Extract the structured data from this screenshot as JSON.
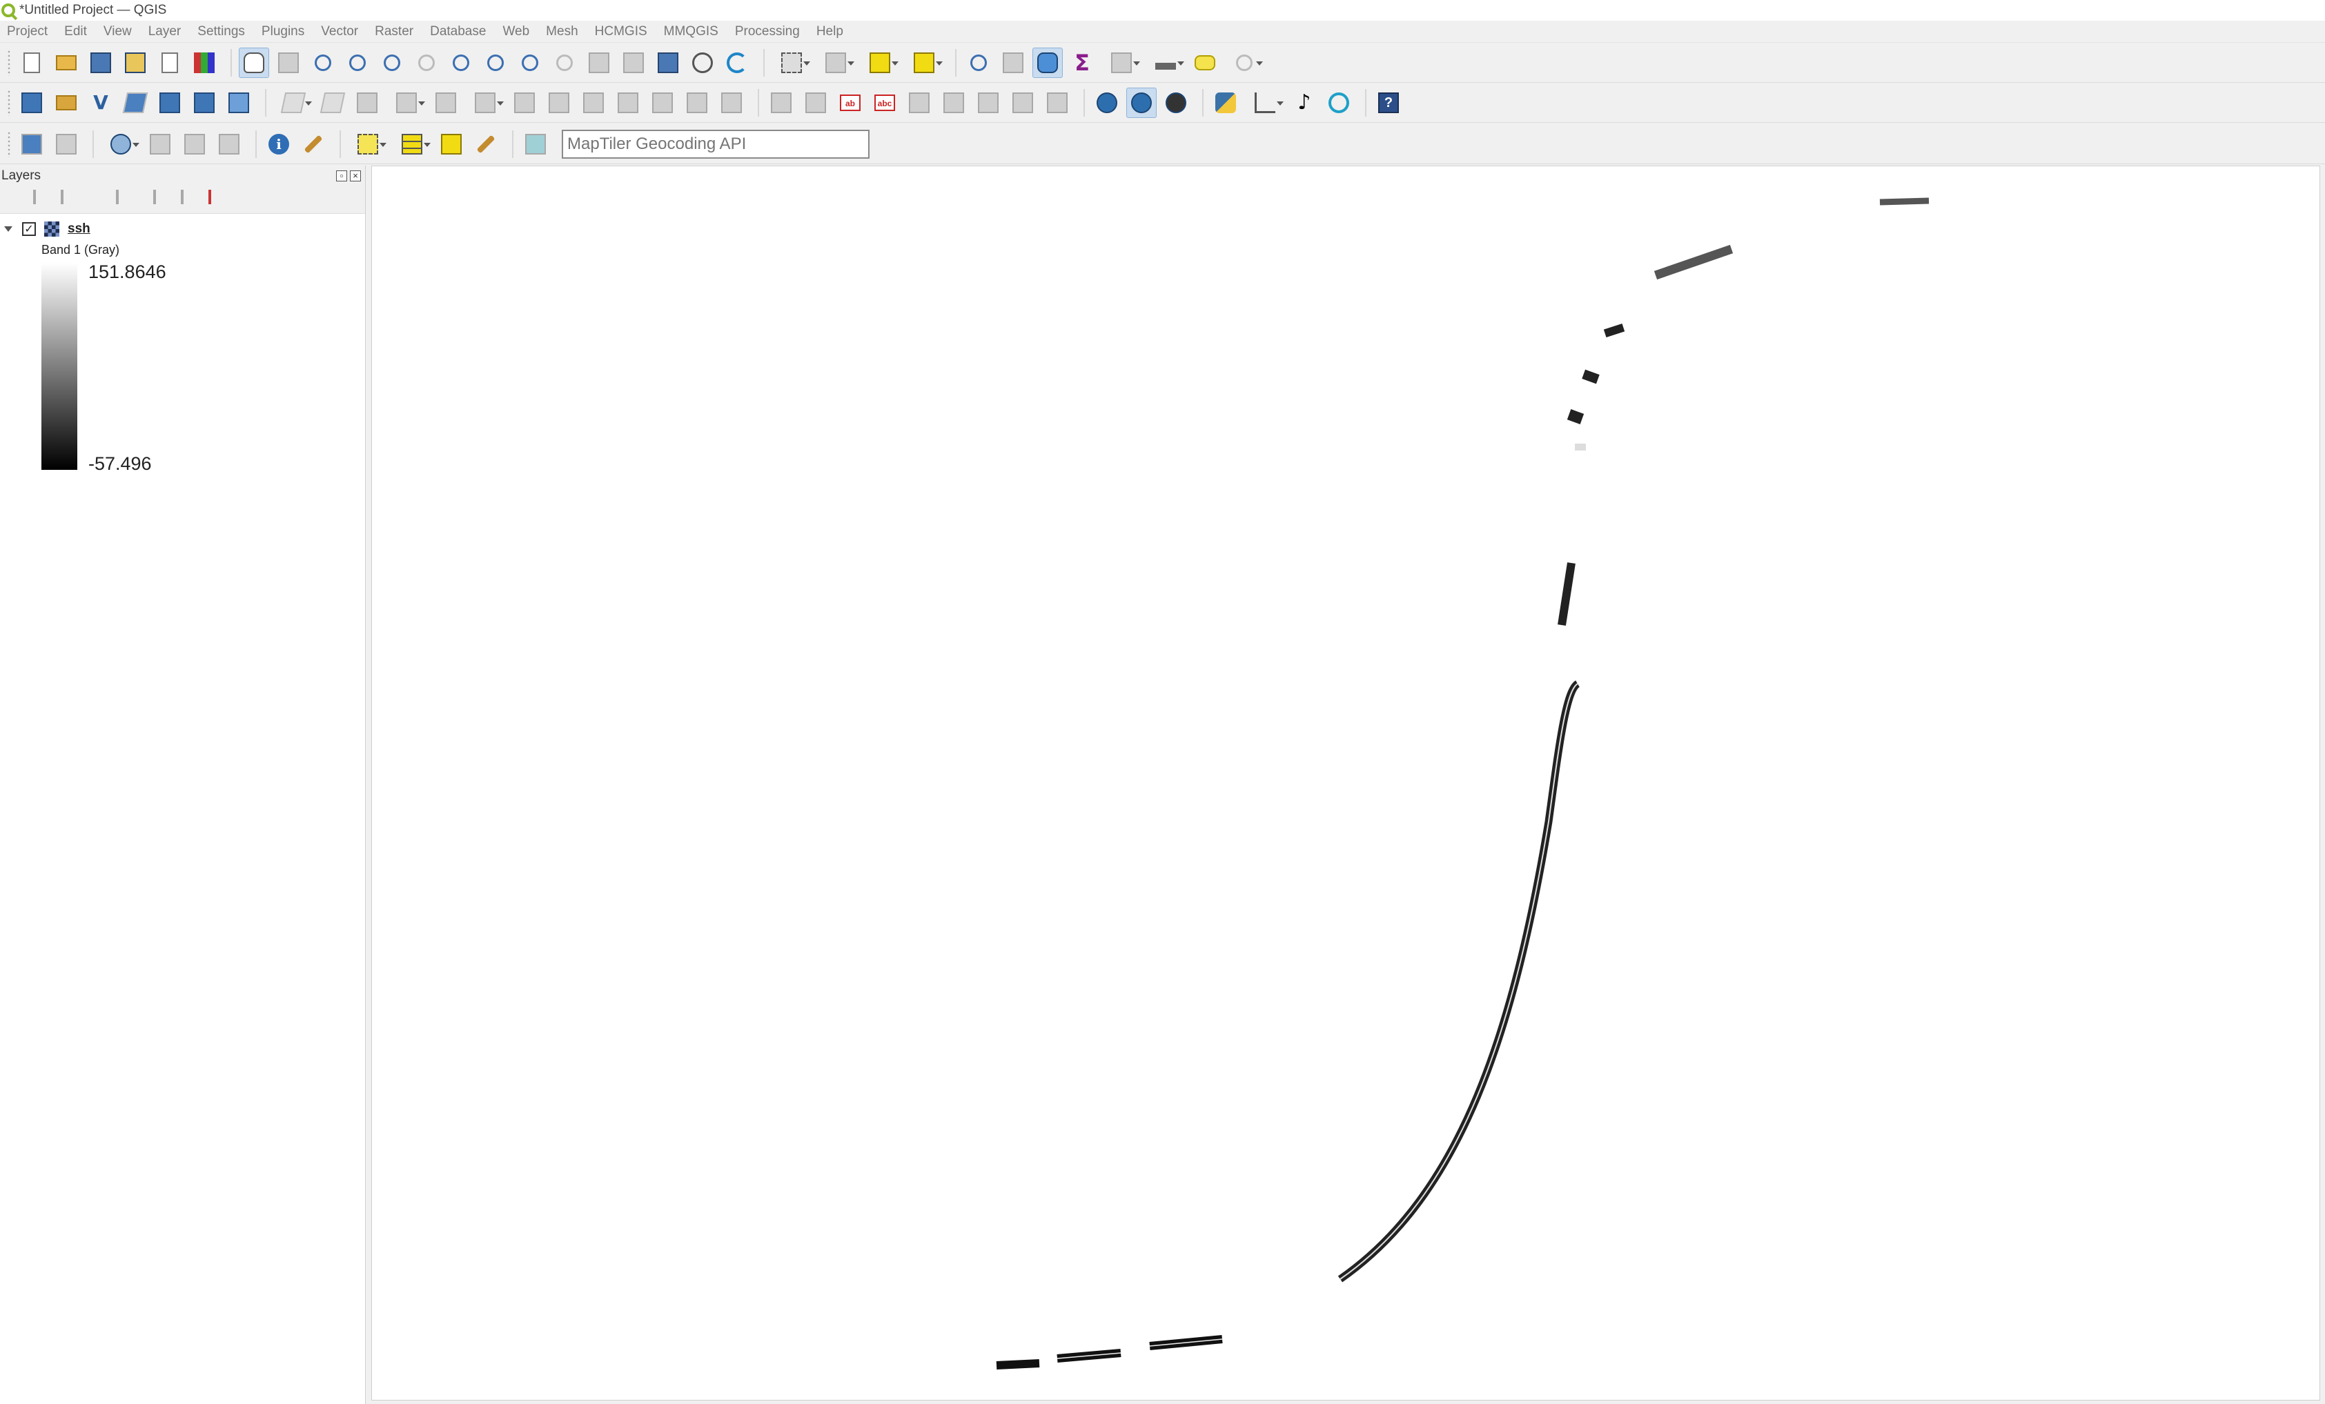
{
  "window": {
    "title": "*Untitled Project — QGIS"
  },
  "menu": [
    "Project",
    "Edit",
    "View",
    "Layer",
    "Settings",
    "Plugins",
    "Vector",
    "Raster",
    "Database",
    "Web",
    "Mesh",
    "HCMGIS",
    "MMQGIS",
    "Processing",
    "Help"
  ],
  "search": {
    "placeholder": "MapTiler Geocoding API"
  },
  "layers_panel": {
    "title": "Layers",
    "layers": [
      {
        "name": "ssh",
        "checked": true,
        "band": "Band 1 (Gray)",
        "legend_max": "151.8646",
        "legend_min": "-57.496"
      }
    ]
  },
  "icons": {
    "toolbar1": [
      "new-project-icon",
      "open-project-icon",
      "save-project-icon",
      "save-as-icon",
      "print-layout-icon",
      "style-manager-icon",
      "pan-map-icon",
      "pan-to-selection-icon",
      "zoom-in-icon",
      "zoom-out-icon",
      "zoom-full-icon",
      "zoom-selection-icon",
      "zoom-layer-icon",
      "zoom-native-icon",
      "zoom-last-icon",
      "zoom-next-icon",
      "new-bookmark-icon",
      "show-bookmarks-icon",
      "temporal-controller-icon",
      "refresh-icon"
    ],
    "toolbar2": [
      "data-source-manager-icon",
      "new-geopackage-icon",
      "new-shapefile-icon",
      "new-spatialite-icon",
      "new-memory-layer-icon",
      "new-virtual-layer-icon",
      "python-console-icon",
      "help-icon"
    ]
  },
  "colors": {
    "background": "#f0f0f0",
    "canvas": "#ffffff",
    "active_tool": "#c9dcf0",
    "track": "#222222"
  }
}
